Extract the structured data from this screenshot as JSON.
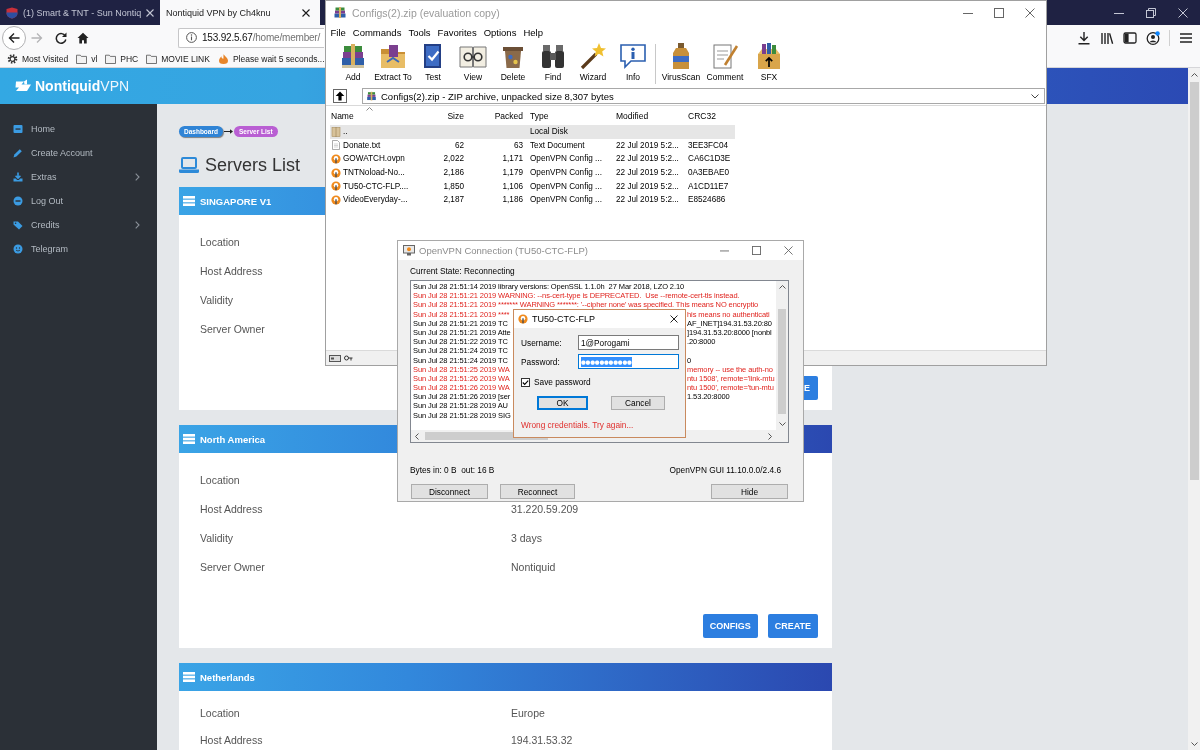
{
  "browser": {
    "tabs": [
      {
        "title": "(1) Smart & TNT - Sun Nontiq",
        "has_icon": true,
        "selected": false
      },
      {
        "title": "Nontiquid VPN by Ch4knu",
        "has_icon": false,
        "selected": true
      }
    ],
    "url": {
      "host": "153.92.5.67",
      "path": "/home/member/"
    },
    "bookmarks": [
      {
        "label": "Most Visited",
        "kind": "gear"
      },
      {
        "label": "vl",
        "kind": "folder"
      },
      {
        "label": "PHC",
        "kind": "folder"
      },
      {
        "label": "MOVIE LINK",
        "kind": "folder"
      },
      {
        "label": "Please wait 5 seconds...",
        "kind": "page"
      }
    ]
  },
  "site": {
    "logo": "**Nontiquid**VPN",
    "sidebar": [
      {
        "label": "Home",
        "kind": "home",
        "submenu": false
      },
      {
        "label": "Create Account",
        "kind": "pencil",
        "submenu": false
      },
      {
        "label": "Extras",
        "kind": "download",
        "submenu": true
      },
      {
        "label": "Log Out",
        "kind": "logout",
        "submenu": false
      },
      {
        "label": "Credits",
        "kind": "tags",
        "submenu": true
      },
      {
        "label": "Telegram",
        "kind": "smiley",
        "submenu": false
      }
    ],
    "breadcrumb": [
      "Dashboard",
      "Server List"
    ],
    "title": "Servers List",
    "cards": [
      {
        "title": "SINGAPORE V1",
        "rows": [
          {
            "label": "Location"
          },
          {
            "label": "Host Address"
          },
          {
            "label": "Validity"
          },
          {
            "label": "Server Owner"
          }
        ],
        "buttons": [
          {
            "label": "E",
            "cut": true
          }
        ]
      },
      {
        "title": "North America",
        "rows": [
          {
            "label": "Location"
          },
          {
            "label": "Host Address",
            "value": "31.220.59.209"
          },
          {
            "label": "Validity",
            "value": "3 days"
          },
          {
            "label": "Server Owner",
            "value": "Nontiquid"
          }
        ],
        "buttons": [
          {
            "label": "CONFIGS",
            "cut": false
          },
          {
            "label": "CREATE",
            "cut": false
          }
        ]
      },
      {
        "title": "Netherlands",
        "rows": [
          {
            "label": "Location",
            "value": "Europe"
          },
          {
            "label": "Host Address",
            "value": "194.31.53.32"
          }
        ]
      }
    ]
  },
  "winrar": {
    "title": "Configs(2).zip (evaluation copy)",
    "active": false,
    "menu": [
      "File",
      "Commands",
      "Tools",
      "Favorites",
      "Options",
      "Help"
    ],
    "tool_groups": [
      [
        {
          "label": "Add",
          "kind": "add"
        },
        {
          "label": "Extract To",
          "kind": "extract"
        },
        {
          "label": "Test",
          "kind": "test"
        },
        {
          "label": "View",
          "kind": "view"
        },
        {
          "label": "Delete",
          "kind": "delete"
        },
        {
          "label": "Find",
          "kind": "find"
        },
        {
          "label": "Wizard",
          "kind": "wizard"
        },
        {
          "label": "Info",
          "kind": "info"
        }
      ],
      [
        {
          "label": "VirusScan",
          "kind": "virusscan"
        },
        {
          "label": "Comment",
          "kind": "comment"
        },
        {
          "label": "SFX",
          "kind": "sfx"
        }
      ]
    ],
    "path": "Configs(2).zip - ZIP archive, unpacked size 8,307 bytes",
    "columns": [
      "Name",
      "Size",
      "Packed",
      "Type",
      "Modified",
      "CRC32"
    ],
    "rows": [
      {
        "kind": "parent",
        "name": "..",
        "type": "Local Disk",
        "selected": true
      },
      {
        "kind": "text",
        "name": "Donate.txt",
        "size": "62",
        "packed": "63",
        "type": "Text Document",
        "modified": "22 Jul 2019 5:2...",
        "crc32": "3EE3FC04",
        "selected": false
      },
      {
        "kind": "config",
        "name": "GOWATCH.ovpn",
        "size": "2,022",
        "packed": "1,171",
        "type": "OpenVPN Config ...",
        "modified": "22 Jul 2019 5:2...",
        "crc32": "CA6C1D3E",
        "selected": false
      },
      {
        "kind": "config",
        "name": "TNTNoload-No...",
        "size": "2,186",
        "packed": "1,179",
        "type": "OpenVPN Config ...",
        "modified": "22 Jul 2019 5:2...",
        "crc32": "0A3EBAE0",
        "selected": false
      },
      {
        "kind": "config",
        "name": "TU50-CTC-FLP....",
        "size": "1,850",
        "packed": "1,106",
        "type": "OpenVPN Config ...",
        "modified": "22 Jul 2019 5:2...",
        "crc32": "A1CD11E7",
        "selected": false
      },
      {
        "kind": "config",
        "name": "VideoEveryday-...",
        "size": "2,187",
        "packed": "1,186",
        "type": "OpenVPN Config ...",
        "modified": "22 Jul 2019 5:2...",
        "crc32": "E8524686",
        "selected": false
      }
    ]
  },
  "openvpn": {
    "title": "OpenVPN Connection (TU50-CTC-FLP)",
    "active": false,
    "state": "Current State: Reconnecting",
    "log": [
      {
        "text": "Sun Jul 28 21:51:14 2019 library versions: OpenSSL 1.1.0h  27 Mar 2018, LZO 2.10",
        "kind": "info"
      },
      {
        "text": "Sun Jul 28 21:51:21 2019 WARNING: --ns-cert-type is DEPRECATED.  Use --remote-cert-tls instead.",
        "kind": "warning"
      },
      {
        "text": "Sun Jul 28 21:51:21 2019 ******* WARNING *******: '--cipher none' was specified. This means NO encryptio",
        "kind": "warning"
      },
      {
        "text": "Sun Jul 28 21:51:21 2019 ****",
        "tail": "his means no authenticati",
        "kind": "warning"
      },
      {
        "text": "Sun Jul 28 21:51:21 2019 TC",
        "tail": "AF_INET]194.31.53.20:80",
        "kind": "info"
      },
      {
        "text": "Sun Jul 28 21:51:21 2019 Atte",
        "tail": "]194.31.53.20:8000 [nonbl",
        "kind": "info"
      },
      {
        "text": "Sun Jul 28 21:51:22 2019 TC",
        "tail": ".20:8000",
        "kind": "info"
      },
      {
        "text": "Sun Jul 28 21:51:24 2019 TC",
        "kind": "info"
      },
      {
        "text": "Sun Jul 28 21:51:24 2019 TC",
        "tail": "0",
        "kind": "info"
      },
      {
        "text": "Sun Jul 28 21:51:25 2019 WA",
        "tail": "memory -- use the auth-no",
        "kind": "warning"
      },
      {
        "text": "Sun Jul 28 21:51:26 2019 WA",
        "tail": "ntu 1508', remote='link-mtu",
        "kind": "warning"
      },
      {
        "text": "Sun Jul 28 21:51:26 2019 WA",
        "tail": "ntu 1500', remote='tun-mtu",
        "kind": "warning"
      },
      {
        "text": "Sun Jul 28 21:51:26 2019 [ser",
        "tail": "1.53.20:8000",
        "kind": "info"
      },
      {
        "text": "Sun Jul 28 21:51:28 2019 AU",
        "kind": "info"
      },
      {
        "text": "Sun Jul 28 21:51:28 2019 SIG",
        "kind": "info"
      }
    ],
    "bytes": "Bytes in: 0 B  out: 16 B",
    "version": "OpenVPN GUI 11.10.0.0/2.4.6",
    "buttons": [
      "Disconnect",
      "Reconnect",
      "Hide"
    ],
    "auth_dialog": {
      "title": "TU50-CTC-FLP",
      "active": true,
      "fields": [
        {
          "label": "Username:",
          "value": "1@Porogami",
          "masked": false,
          "focused": false
        },
        {
          "label": "Password:",
          "value": "●●●●●●●●●●●",
          "masked": true,
          "focused": true
        }
      ],
      "save_password": {
        "label": "Save password",
        "checked": true
      },
      "buttons": [
        {
          "label": "OK",
          "default": true
        },
        {
          "label": "Cancel",
          "default": false
        }
      ],
      "error": "Wrong credentials. Try again..."
    }
  }
}
